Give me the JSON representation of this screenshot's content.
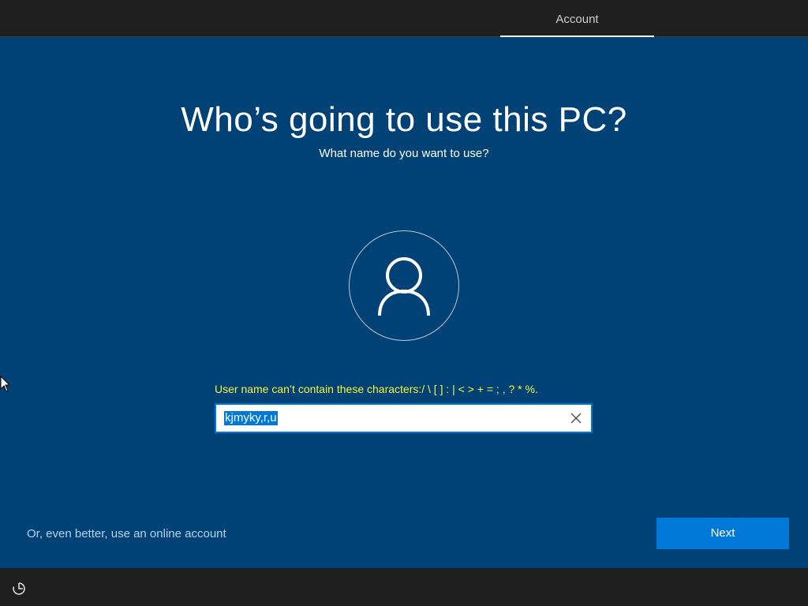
{
  "header": {
    "tabs": [
      {
        "label": "Account",
        "active": true
      }
    ]
  },
  "main": {
    "title": "Who’s going to use this PC?",
    "subtitle": "What name do you want to use?",
    "avatar_icon": "user-silhouette-icon",
    "error_message": "User name can’t contain these characters:/ \\ [ ] : | < > + = ; , ? * %.",
    "username": {
      "value": "kjmyky,r,u",
      "selected": true,
      "clear_icon": "close-icon"
    }
  },
  "footer": {
    "online_account_link": "Or, even better, use an online account",
    "next_label": "Next",
    "ease_of_access_icon": "ease-of-access-icon"
  },
  "colors": {
    "background": "#004275",
    "bar": "#1f1f1f",
    "accent": "#0078d7",
    "error": "#f6f63a",
    "link": "#b3d4ef"
  }
}
